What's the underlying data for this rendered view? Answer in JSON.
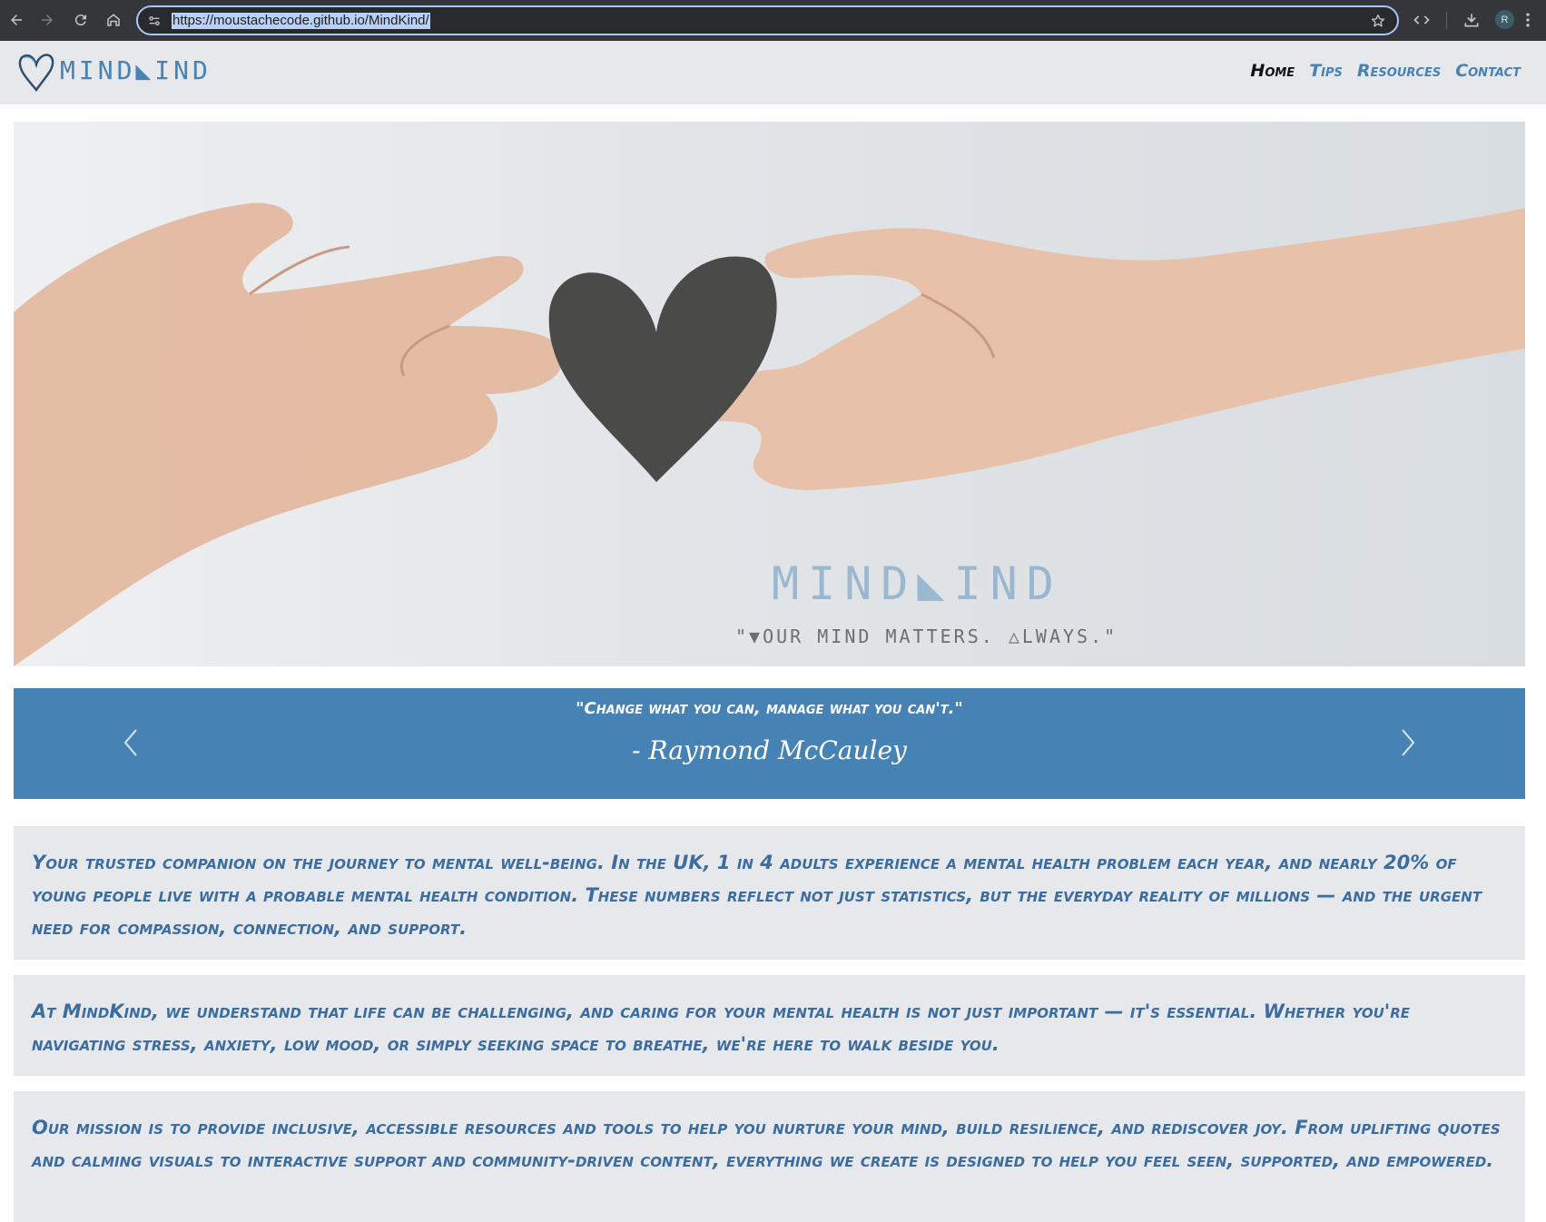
{
  "browser": {
    "url": "https://moustachecode.github.io/MindKind/",
    "profile_initial": "R",
    "icons": [
      "back-icon",
      "forward-icon",
      "reload-icon",
      "home-icon",
      "site-info-icon",
      "bookmark-star-icon",
      "code-icon",
      "download-icon",
      "menu-dots-icon"
    ]
  },
  "header": {
    "logo_text": "MIND◣IND",
    "nav": [
      {
        "label": "Home",
        "active": true
      },
      {
        "label": "Tips",
        "active": false
      },
      {
        "label": "Resources",
        "active": false
      },
      {
        "label": "Contact",
        "active": false
      }
    ]
  },
  "hero": {
    "title": "MIND◣IND",
    "tagline": "\"▼OUR MIND MATTERS. △LWAYS.\""
  },
  "quote": {
    "text": "\"Change what you can, manage what you can't.\"",
    "author": "- Raymond McCauley"
  },
  "content": {
    "paragraphs": [
      "Your trusted companion on the journey to mental well-being. In the UK, 1 in 4 adults experience a mental health problem each year, and nearly 20% of young people live with a probable mental health condition. These numbers reflect not just statistics, but the everyday reality of millions — and the urgent need for compassion, connection, and support.",
      "At MindKind, we understand that life can be challenging, and caring for your mental health is not just important — it's essential. Whether you're navigating stress, anxiety, low mood, or simply seeking space to breathe, we're here to walk beside you.",
      "Our mission is to provide inclusive, accessible resources and tools to help you nurture your mind, build resilience, and rediscover joy. From uplifting quotes and calming visuals to interactive support and community-driven content, everything we create is designed to help you feel seen, supported, and empowered."
    ]
  },
  "colors": {
    "brand_blue": "#4682b4",
    "panel_bg": "#e7e8eb",
    "text_blue": "#3c6d9e",
    "chrome_bg": "#35363a"
  }
}
